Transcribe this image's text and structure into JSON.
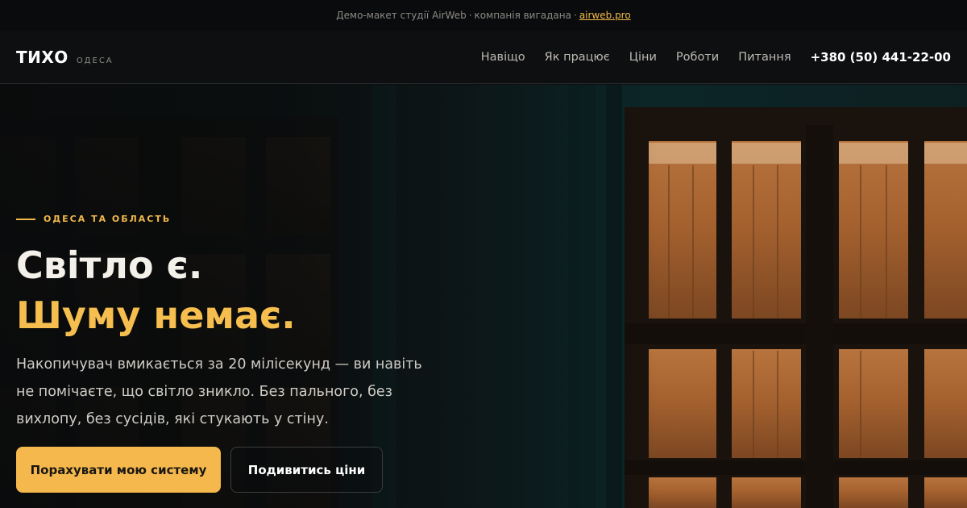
{
  "topbar": {
    "note": "Демо-макет студії AirWeb",
    "separator": "·",
    "disclaimer": "компанія вигадана",
    "link": "airweb.pro"
  },
  "header": {
    "logo": "ТИХО",
    "city": "ОДЕСА",
    "nav": [
      "Навіщо",
      "Як працює",
      "Ціни",
      "Роботи",
      "Питання"
    ],
    "phone": "+380 (50) 441-22-00"
  },
  "hero": {
    "eyebrow": "ОДЕСА ТА ОБЛАСТЬ",
    "title_line1": "Світло є.",
    "title_line2": "Шуму немає.",
    "description": "Накопичувач вмикається за 20 мілісекунд — ви навіть не помічаєте, що світло зникло. Без пального, без вихлопу, без сусідів, які стукають у стіну.",
    "primary_button": "Порахувати мою систему",
    "secondary_button": "Подивитись ціни"
  },
  "colors": {
    "accent": "#f4b84c",
    "background": "#0c0d0e",
    "window_glow": "#c87a3a"
  }
}
